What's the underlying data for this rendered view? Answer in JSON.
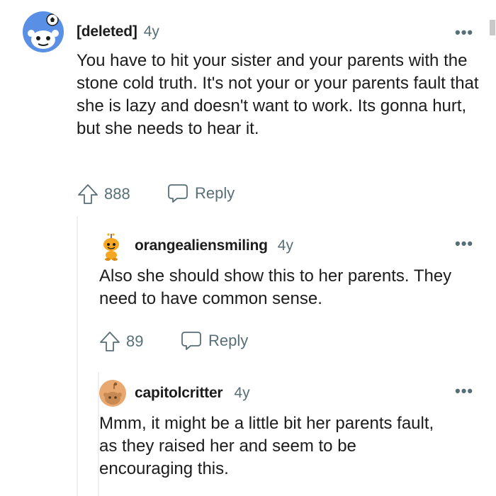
{
  "comments": [
    {
      "author": "[deleted]",
      "age": "4y",
      "text": "You have to hit your sister and your parents with the stone cold truth. It's not your or your parents fault that she is lazy and doesn't want to work. Its gonna hurt, but she needs to hear it.",
      "votes": "888",
      "reply_label": "Reply",
      "more_label": "•••",
      "avatar_icon": "snoo-avatar-icon"
    },
    {
      "author": "orangealiensmiling",
      "age": "4y",
      "text": "Also she should show this to her parents. They need to have common sense.",
      "votes": "89",
      "reply_label": "Reply",
      "more_label": "•••",
      "avatar_icon": "orange-snoo-icon"
    },
    {
      "author": "capitolcritter",
      "age": "4y",
      "text": "Mmm, it might be a little bit her parents fault, as they raised her and seem to be encouraging this.",
      "more_label": "•••",
      "avatar_icon": "tan-snoo-avatar-icon"
    }
  ],
  "colors": {
    "meta": "#576f76",
    "text": "#1c1c1c",
    "avatar_blue": "#5a8fe6",
    "avatar_tan": "#e9a870"
  }
}
